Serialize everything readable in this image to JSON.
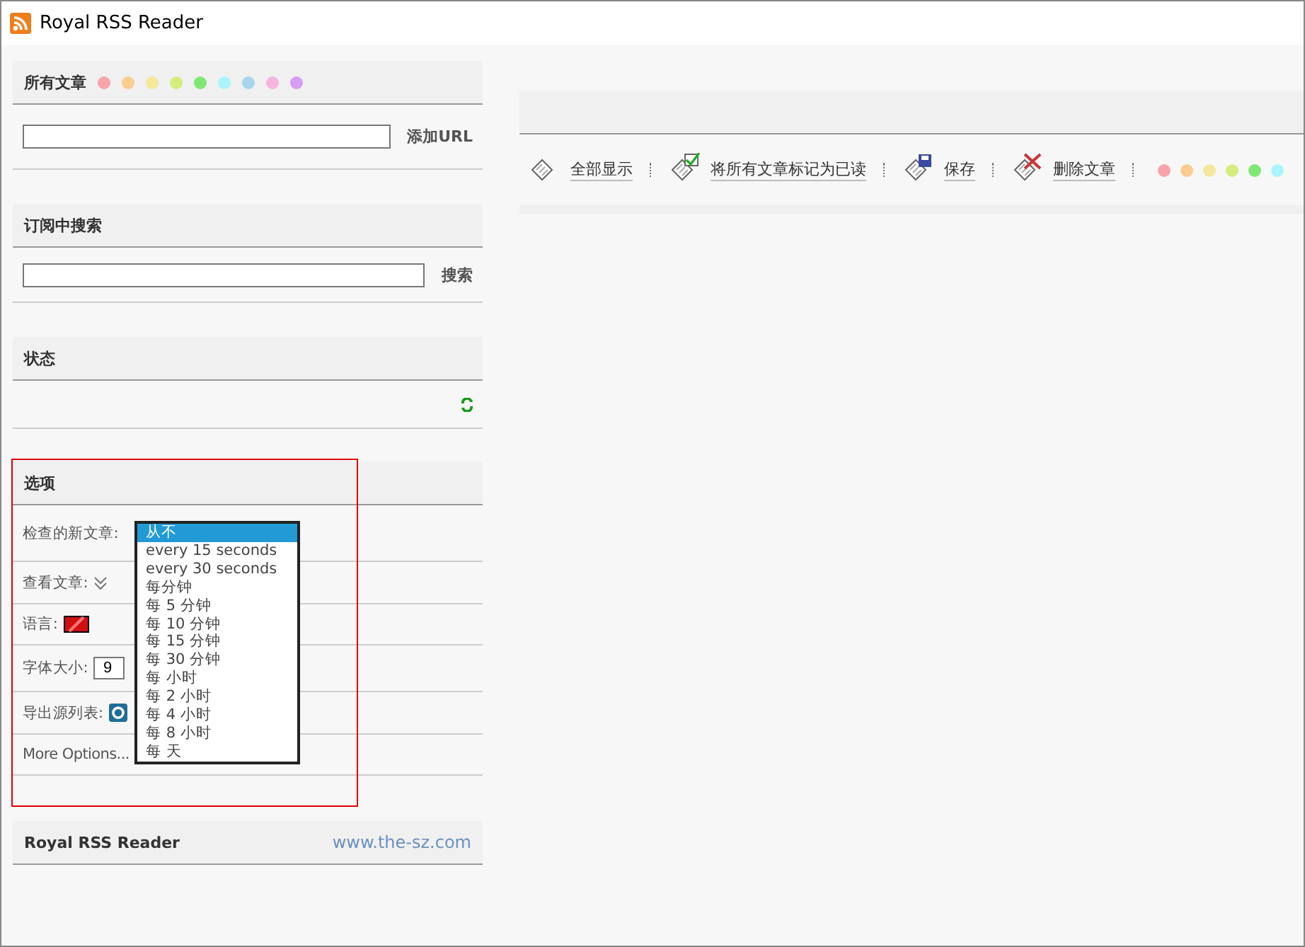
{
  "window": {
    "title": "Royal RSS Reader"
  },
  "all_articles": {
    "title": "所有文章",
    "color_filters": [
      {
        "color": "#f9a3aa"
      },
      {
        "color": "#fbcc90"
      },
      {
        "color": "#f5e79c"
      },
      {
        "color": "#d3ee7c"
      },
      {
        "color": "#80e872"
      },
      {
        "color": "#aaf5fb"
      },
      {
        "color": "#a7d5ec"
      },
      {
        "color": "#f6b6dc"
      },
      {
        "color": "#d79cf3"
      }
    ],
    "add_url_button": "添加URL"
  },
  "search": {
    "title": "订阅中搜索",
    "button": "搜索"
  },
  "status": {
    "title": "状态"
  },
  "options": {
    "title": "选项",
    "highlighted": true,
    "rows": [
      {
        "kind": "dropdown",
        "label": "检查的新文章:"
      },
      {
        "kind": "view",
        "label": "查看文章:"
      },
      {
        "kind": "flag",
        "label": "语言:"
      },
      {
        "kind": "number",
        "label": "字体大小:",
        "value": "9"
      },
      {
        "kind": "export",
        "label": "导出源列表:"
      },
      {
        "kind": "link",
        "label": "More Options..."
      }
    ],
    "dropdown_options": [
      {
        "label": "从不",
        "selected": true
      },
      {
        "label": "every 15 seconds",
        "selected": false
      },
      {
        "label": "every 30 seconds",
        "selected": false
      },
      {
        "label": "每分钟",
        "selected": false
      },
      {
        "label": "每 5 分钟",
        "selected": false
      },
      {
        "label": "每 10 分钟",
        "selected": false
      },
      {
        "label": "每 15 分钟",
        "selected": false
      },
      {
        "label": "每 30 分钟",
        "selected": false
      },
      {
        "label": "每 小时",
        "selected": false
      },
      {
        "label": "每 2 小时",
        "selected": false
      },
      {
        "label": "每 4 小时",
        "selected": false
      },
      {
        "label": "每 8 小时",
        "selected": false
      },
      {
        "label": "每 天",
        "selected": false
      }
    ]
  },
  "footer": {
    "title": "Royal RSS Reader",
    "link": "www.the-sz.com"
  },
  "toolbar": {
    "buttons": [
      {
        "kind": "show",
        "label": "全部显示"
      },
      {
        "kind": "read",
        "label": "将所有文章标记为已读"
      },
      {
        "kind": "save",
        "label": "保存"
      },
      {
        "kind": "delete",
        "label": "删除文章"
      }
    ],
    "color_filters": [
      {
        "color": "#f9a3aa"
      },
      {
        "color": "#fbcc90"
      },
      {
        "color": "#f5e79c"
      },
      {
        "color": "#d3ee7c"
      },
      {
        "color": "#80e872"
      },
      {
        "color": "#aaf5fb"
      }
    ]
  }
}
